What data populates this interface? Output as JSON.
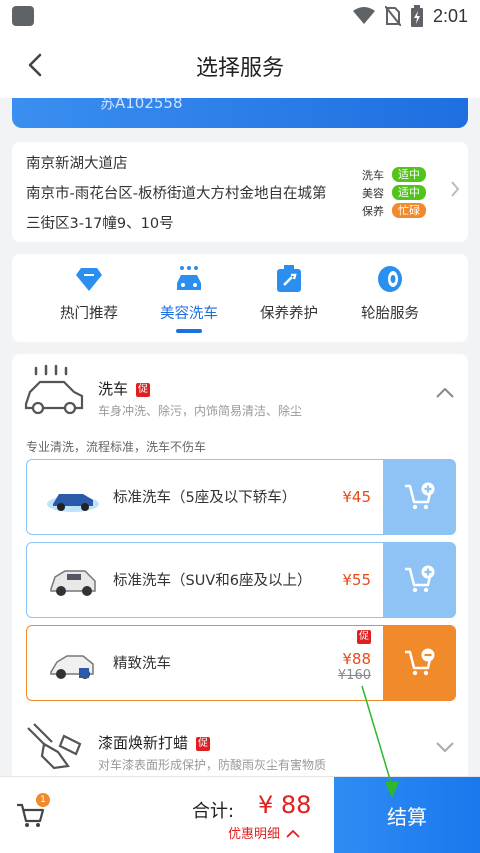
{
  "status_bar": {
    "time": "2:01"
  },
  "nav": {
    "title": "选择服务"
  },
  "vehicle": {
    "plate_partial": "苏A102558"
  },
  "store": {
    "name": "南京新湖大道店",
    "address_line1": "南京市-雨花台区-板桥街道大方村金地自在城第",
    "address_line2": "三街区3-17幢9、10号",
    "status": [
      {
        "label": "洗车",
        "badge": "适中",
        "color": "#52c41a"
      },
      {
        "label": "美容",
        "badge": "适中",
        "color": "#52c41a"
      },
      {
        "label": "保养",
        "badge": "忙碌",
        "color": "#f08a2a"
      }
    ]
  },
  "categories": [
    {
      "label": "热门推荐",
      "icon": "gem-icon",
      "active": false
    },
    {
      "label": "美容洗车",
      "icon": "car-wash-icon",
      "active": true
    },
    {
      "label": "保养养护",
      "icon": "maintenance-icon",
      "active": false
    },
    {
      "label": "轮胎服务",
      "icon": "tire-icon",
      "active": false
    }
  ],
  "groups": [
    {
      "title": "洗车",
      "promo": "促",
      "desc": "车身冲洗、除污，内饰简易清洁、除尘",
      "icon": "car-wash-outline-icon",
      "expanded": true
    },
    {
      "title": "漆面焕新打蜡",
      "promo": "促",
      "desc": "对车漆表面形成保护，防酸雨灰尘有害物质",
      "icon": "polisher-icon",
      "expanded": false
    }
  ],
  "wash_note": "专业清洗，流程标准，洗车不伤车",
  "wash_items": [
    {
      "name": "标准洗车（5座及以下轿车）",
      "price": "¥45",
      "original": "",
      "promo": "",
      "selected": false
    },
    {
      "name": "标准洗车（SUV和6座及以上）",
      "price": "¥55",
      "original": "",
      "promo": "",
      "selected": false
    },
    {
      "name": "精致洗车",
      "price": "¥88",
      "original": "¥160",
      "promo": "促",
      "selected": true
    }
  ],
  "bottom": {
    "cart_count": "1",
    "total_label": "合计:",
    "total_value": "¥ 88",
    "discount_label": "优惠明细",
    "checkout_label": "结算"
  },
  "colors": {
    "primary": "#1e6fe0",
    "accent_orange": "#f08a2a",
    "price_red": "#e02020"
  }
}
